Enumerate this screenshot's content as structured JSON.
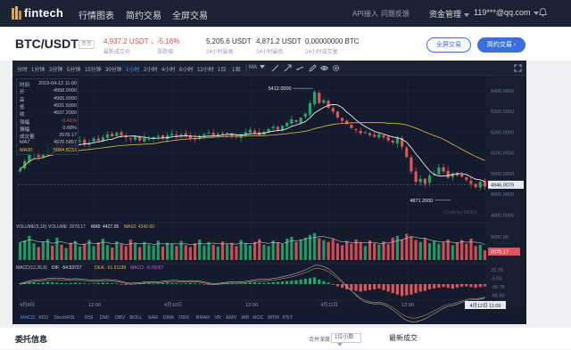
{
  "nav": {
    "logo_text": "fintech",
    "items": [
      "行情图表",
      "简约交易",
      "全屏交易"
    ],
    "right_links": [
      "API接入",
      "问题反馈"
    ],
    "asset_menu": "资金管理",
    "user": "119***@qq.com"
  },
  "ticker": {
    "pair": "BTC/USDT",
    "tag": "币币",
    "last_price": "4,937.2 USDT",
    "last_arrow": "↓",
    "last_label": "最新成交价",
    "change": "-5.16%",
    "change_label": "涨跌幅",
    "high": "5,205.6 USDT",
    "high_label": "24小时最高",
    "low": "4,871.2 USDT",
    "low_label": "24小时最低",
    "volume": "0.00000000 BTC",
    "volume_label": "24小时成交量",
    "btn_fullscreen": "全屏交易",
    "btn_simple": "简约交易"
  },
  "toolbar": {
    "intervals": [
      "分时",
      "1分钟",
      "3分钟",
      "5分钟",
      "15分钟",
      "30分钟",
      "1小时",
      "2小时",
      "4小时",
      "6小时",
      "12小时",
      "1日",
      "1周"
    ],
    "active_interval": "1小时",
    "ma_label": "MA"
  },
  "info": {
    "rows": [
      {
        "k": "时间",
        "v": "2019-04-12 11:00"
      },
      {
        "k": "开",
        "v": "4958.0000"
      },
      {
        "k": "高",
        "v": "4965.0000"
      },
      {
        "k": "低",
        "v": "4931.5000"
      },
      {
        "k": "收",
        "v": "4937.2000"
      },
      {
        "k": "涨幅",
        "v": "-0.41%"
      },
      {
        "k": "振幅",
        "v": "0.68%"
      },
      {
        "k": "成交量",
        "v": "2078.17"
      },
      {
        "k": "MA7",
        "v": "4976.5857"
      },
      {
        "k": "MA30",
        "v": "5084.8233"
      }
    ]
  },
  "chart_data": {
    "type": "candlestick",
    "title": "BTC/USDT 1小时",
    "price_axis": [
      "5400.0000",
      "5300.0000",
      "5200.0000",
      "5100.0000",
      "5000.0000",
      "4900.0000",
      "4800.0000"
    ],
    "y_range": [
      4780,
      5460
    ],
    "time_labels": [
      "4月8日",
      "12:00",
      "4月10日",
      "12:00",
      "4月11日",
      "12:00",
      "4月12日"
    ],
    "cursor_time": "4月12日 11:00",
    "current_price": "4946.0079",
    "high_marker": "5412.0000",
    "low_marker": "4871.2000",
    "watermark": "Chart by OKEX",
    "ma7_color": "#ffffff",
    "ma30_color": "#e7b84b",
    "up_color": "#23a66b",
    "down_color": "#e0535a",
    "closes": [
      5020,
      5060,
      5095,
      5110,
      5080,
      5100,
      5130,
      5118,
      5145,
      5128,
      5140,
      5135,
      5152,
      5160,
      5140,
      5150,
      5170,
      5158,
      5175,
      5190,
      5180,
      5198,
      5185,
      5175,
      5165,
      5178,
      5160,
      5172,
      5168,
      5175,
      5182,
      5170,
      5185,
      5192,
      5178,
      5188,
      5180,
      5172,
      5165,
      5178,
      5190,
      5198,
      5185,
      5192,
      5188,
      5195,
      5182,
      5176,
      5190,
      5200,
      5212,
      5196,
      5188,
      5202,
      5215,
      5226,
      5212,
      5230,
      5245,
      5262,
      5250,
      5270,
      5290,
      5340,
      5395,
      5340,
      5355,
      5318,
      5300,
      5270,
      5255,
      5240,
      5220,
      5210,
      5195,
      5200,
      5185,
      5178,
      5190,
      5175,
      5160,
      5150,
      5175,
      5130,
      5080,
      5010,
      4960,
      4975,
      4950,
      4990,
      5000,
      5030,
      5010,
      4980,
      5000,
      4990,
      4985,
      4970,
      4950,
      4935,
      4960,
      4937
    ],
    "volume_label": "VOLUME(5,10)",
    "volume_value": "VOLUME: 2078.17",
    "volume_ma5": "MA5: 4427.05",
    "volume_ma10": "MA10: 4242.60",
    "volume_axis": [
      "5000.00",
      "2078.17"
    ],
    "volume_values": [
      3800,
      4200,
      5200,
      3600,
      2800,
      3900,
      4500,
      3100,
      4800,
      3300,
      2600,
      3700,
      4100,
      2900,
      3500,
      4300,
      3000,
      3800,
      4600,
      3200,
      2700,
      4000,
      3400,
      3000,
      4400,
      3600,
      2800,
      3900,
      3300,
      3100,
      4200,
      2900,
      3700,
      3500,
      3000,
      4100,
      3200,
      2800,
      3600,
      4400,
      3100,
      3900,
      3300,
      2900,
      4000,
      3400,
      3700,
      3000,
      4300,
      3600,
      3200,
      3900,
      4500,
      3300,
      3000,
      4200,
      3800,
      3400,
      4600,
      5000,
      3900,
      4400,
      4800,
      5400,
      5800,
      4700,
      4300,
      3900,
      4500,
      3600,
      3200,
      4100,
      3500,
      4400,
      3800,
      3000,
      4200,
      3600,
      3300,
      4000,
      3500,
      4800,
      5200,
      4400,
      5600,
      5100,
      4300,
      3900,
      4700,
      3600,
      4100,
      3500,
      3800,
      4400,
      3200,
      3700,
      4300,
      3500,
      4600,
      3000,
      3300,
      2100
    ],
    "macd_label": "MACD(12,26,9)",
    "macd_dif": "DIF: -54.53727",
    "macd_dea": "DEA: -51.51199",
    "macd_val": "MACD: -6.05057",
    "macd_axis": [
      "20.78",
      "-5.05",
      "-30.78",
      "-56.59"
    ],
    "macd_hist": [
      2,
      4,
      6,
      5,
      3,
      4,
      6,
      5,
      4,
      3,
      2,
      3,
      4,
      3,
      2,
      1,
      2,
      3,
      4,
      3,
      2,
      1,
      -1,
      -2,
      -1,
      1,
      2,
      3,
      2,
      1,
      2,
      3,
      4,
      3,
      2,
      1,
      2,
      3,
      2,
      1,
      -1,
      -2,
      -1,
      1,
      2,
      3,
      2,
      1,
      2,
      3,
      4,
      5,
      4,
      3,
      4,
      5,
      6,
      7,
      8,
      9,
      10,
      12,
      14,
      16,
      18,
      12,
      8,
      4,
      -2,
      -6,
      -10,
      -14,
      -16,
      -18,
      -20,
      -18,
      -16,
      -14,
      -12,
      -16,
      -20,
      -24,
      -28,
      -32,
      -30,
      -28,
      -24,
      -20,
      -18,
      -14,
      -12,
      -10,
      -8,
      -10,
      -12,
      -9,
      -7,
      -6,
      -8,
      -10,
      -8,
      -6
    ]
  },
  "indicators": {
    "items": [
      "MACD",
      "KDJ",
      "StochRSI",
      "RSI",
      "DMI",
      "OBV",
      "BOLL",
      "SAR",
      "DMA",
      "TRIX",
      "BRAR",
      "VR",
      "EMV",
      "WR",
      "ROC",
      "MTM",
      "PSY"
    ],
    "active": "MACD"
  },
  "bottom": {
    "orders_title": "委托信息",
    "depth_label": "合并深度",
    "depth_value": "1位小数",
    "trades_title": "最新成交"
  }
}
